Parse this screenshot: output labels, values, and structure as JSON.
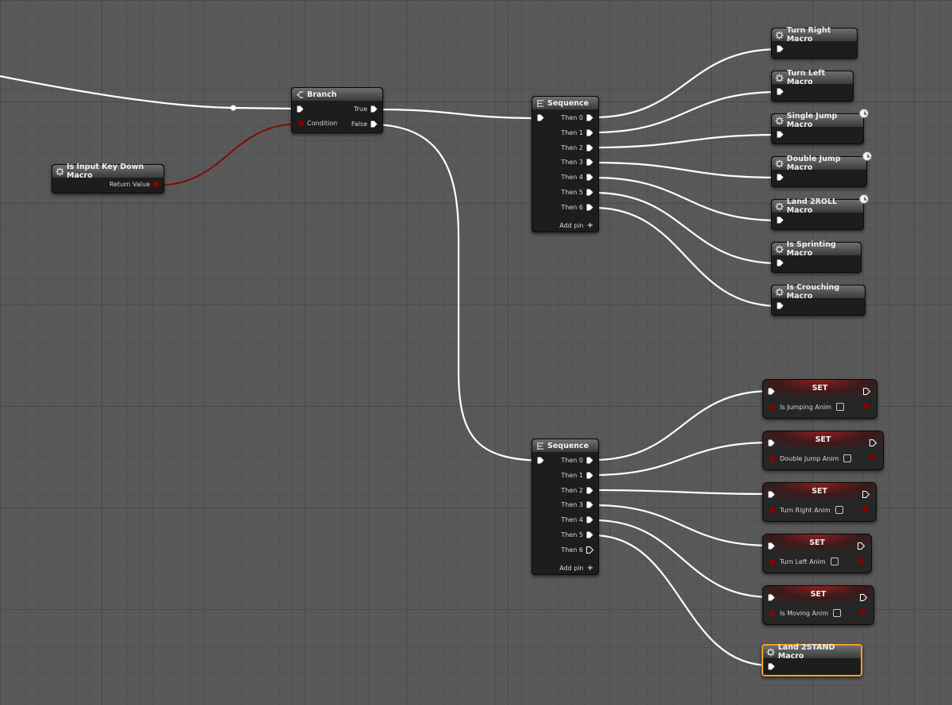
{
  "graph": {
    "key_down": {
      "title": "Is Input Key Down Macro",
      "return_label": "Return Value"
    },
    "branch": {
      "title": "Branch",
      "condition_label": "Condition",
      "true_label": "True",
      "false_label": "False"
    },
    "seq_top": {
      "title": "Sequence",
      "pins": [
        "Then 0",
        "Then 1",
        "Then 2",
        "Then 3",
        "Then 4",
        "Then 5",
        "Then 6"
      ],
      "add_pin": "Add pin"
    },
    "seq_bottom": {
      "title": "Sequence",
      "pins": [
        "Then 0",
        "Then 1",
        "Then 2",
        "Then 3",
        "Then 4",
        "Then 5",
        "Then 6"
      ],
      "add_pin": "Add pin"
    },
    "macros_top": [
      "Turn Right Macro",
      "Turn Left Macro",
      "Single Jump Macro",
      "Double Jump Macro",
      "Land 2ROLL Macro",
      "Is Sprinting Macro",
      "Is Crouching Macro"
    ],
    "set_nodes": [
      {
        "title": "SET",
        "var": "Is Jumping Anim"
      },
      {
        "title": "SET",
        "var": "Double Jump Anim"
      },
      {
        "title": "SET",
        "var": "Turn Right Anim"
      },
      {
        "title": "SET",
        "var": "Turn Left Anim"
      },
      {
        "title": "SET",
        "var": "Is Moving Anim"
      }
    ],
    "land_stand": {
      "title": "Land 2STAND Macro"
    }
  },
  "colors": {
    "exec_wire": "#ffffff",
    "bool_wire": "#8c0000",
    "selection": "#f0a020"
  }
}
